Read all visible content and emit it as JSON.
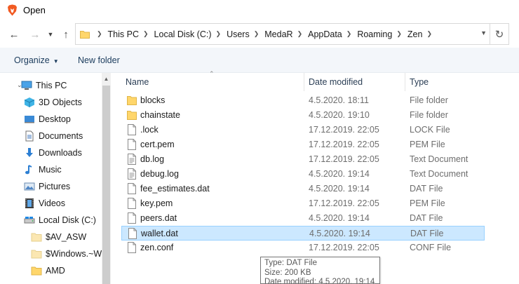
{
  "window": {
    "title": "Open"
  },
  "nav": {
    "breadcrumb": [
      "This PC",
      "Local Disk (C:)",
      "Users",
      "MedaR",
      "AppData",
      "Roaming",
      "Zen"
    ]
  },
  "toolbar": {
    "organize_label": "Organize",
    "new_folder_label": "New folder"
  },
  "sidebar": {
    "items": [
      {
        "label": "This PC",
        "icon": "computer-icon"
      },
      {
        "label": "3D Objects",
        "icon": "cube-icon"
      },
      {
        "label": "Desktop",
        "icon": "desktop-icon"
      },
      {
        "label": "Documents",
        "icon": "document-icon"
      },
      {
        "label": "Downloads",
        "icon": "download-arrow-icon"
      },
      {
        "label": "Music",
        "icon": "music-note-icon"
      },
      {
        "label": "Pictures",
        "icon": "picture-icon"
      },
      {
        "label": "Videos",
        "icon": "film-icon"
      },
      {
        "label": "Local Disk (C:)",
        "icon": "drive-icon"
      },
      {
        "label": "$AV_ASW",
        "icon": "folder-icon"
      },
      {
        "label": "$Windows.~W",
        "icon": "folder-icon"
      },
      {
        "label": "AMD",
        "icon": "folder-icon"
      }
    ]
  },
  "filelist": {
    "columns": {
      "name": "Name",
      "date": "Date modified",
      "type": "Type"
    },
    "rows": [
      {
        "name": "blocks",
        "date": "4.5.2020. 18:11",
        "type": "File folder",
        "icon": "folder-icon"
      },
      {
        "name": "chainstate",
        "date": "4.5.2020. 19:10",
        "type": "File folder",
        "icon": "folder-icon"
      },
      {
        "name": ".lock",
        "date": "17.12.2019. 22:05",
        "type": "LOCK File",
        "icon": "file-icon"
      },
      {
        "name": "cert.pem",
        "date": "17.12.2019. 22:05",
        "type": "PEM File",
        "icon": "file-icon"
      },
      {
        "name": "db.log",
        "date": "17.12.2019. 22:05",
        "type": "Text Document",
        "icon": "text-file-icon"
      },
      {
        "name": "debug.log",
        "date": "4.5.2020. 19:14",
        "type": "Text Document",
        "icon": "text-file-icon"
      },
      {
        "name": "fee_estimates.dat",
        "date": "4.5.2020. 19:14",
        "type": "DAT File",
        "icon": "file-icon"
      },
      {
        "name": "key.pem",
        "date": "17.12.2019. 22:05",
        "type": "PEM File",
        "icon": "file-icon"
      },
      {
        "name": "peers.dat",
        "date": "4.5.2020. 19:14",
        "type": "DAT File",
        "icon": "file-icon"
      },
      {
        "name": "wallet.dat",
        "date": "4.5.2020. 19:14",
        "type": "DAT File",
        "icon": "file-icon",
        "selected": true
      },
      {
        "name": "zen.conf",
        "date": "17.12.2019. 22:05",
        "type": "CONF File",
        "icon": "file-icon"
      }
    ]
  },
  "tooltip": {
    "type_line": "Type: DAT File",
    "size_line": "Size: 200 KB",
    "date_line": "Date modified: 4.5.2020. 19:14"
  },
  "colors": {
    "selection_bg": "#cce8ff",
    "selection_border": "#99d1ff",
    "folder_yellow": "#ffd66b",
    "toolbar_bg": "#f3f6fa",
    "brave_orange": "#f15a22"
  }
}
